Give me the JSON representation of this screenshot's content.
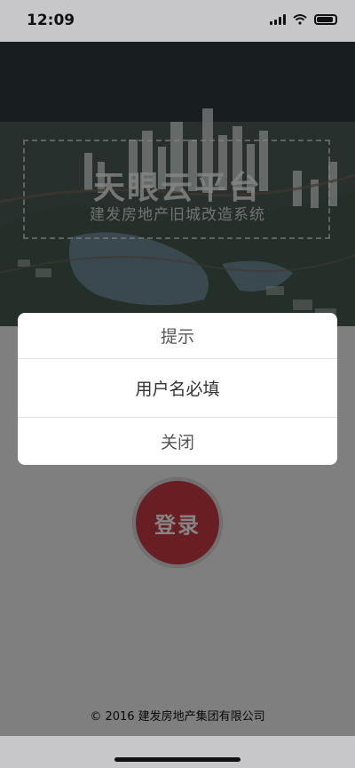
{
  "status_bar": {
    "time": "12:09"
  },
  "hero": {
    "title": "天眼云平台",
    "subtitle": "建发房地产旧城改造系统"
  },
  "login": {
    "button_label": "登录"
  },
  "footer": {
    "copyright": "© 2016  建发房地产集团有限公司"
  },
  "dialog": {
    "title": "提示",
    "message": "用户名必填",
    "close_label": "关闭"
  }
}
